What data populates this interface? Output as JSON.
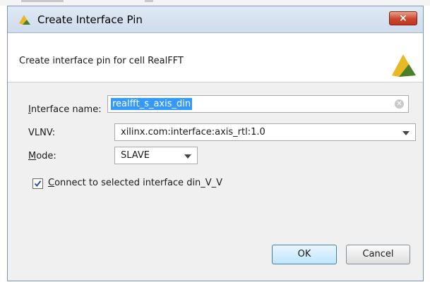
{
  "dialog": {
    "title": "Create Interface Pin",
    "close_label": "×",
    "description": "Create interface pin for cell RealFFT"
  },
  "form": {
    "interface_name": {
      "label_mnemonic": "I",
      "label_rest": "nterface name:",
      "value": "realfft_s_axis_din"
    },
    "vlnv": {
      "label": "VLNV:",
      "value": "xilinx.com:interface:axis_rtl:1.0"
    },
    "mode": {
      "label_mnemonic": "M",
      "label_rest": "ode:",
      "value": "SLAVE"
    },
    "connect": {
      "checked": true,
      "label_mnemonic": "C",
      "label_rest": "onnect to selected interface din_V_V"
    }
  },
  "buttons": {
    "ok": "OK",
    "cancel": "Cancel"
  },
  "icons": {
    "title": "xilinx-logo-icon",
    "header_brand": "xilinx-logo-icon",
    "clear": "clear-icon",
    "dropdown": "chevron-down-icon",
    "check": "check-icon",
    "close": "close-icon"
  },
  "colors": {
    "brand_yellow": "#e9b923",
    "brand_green": "#4a7f2a",
    "selection_blue": "#3399ff",
    "close_red": "#c9462c"
  }
}
